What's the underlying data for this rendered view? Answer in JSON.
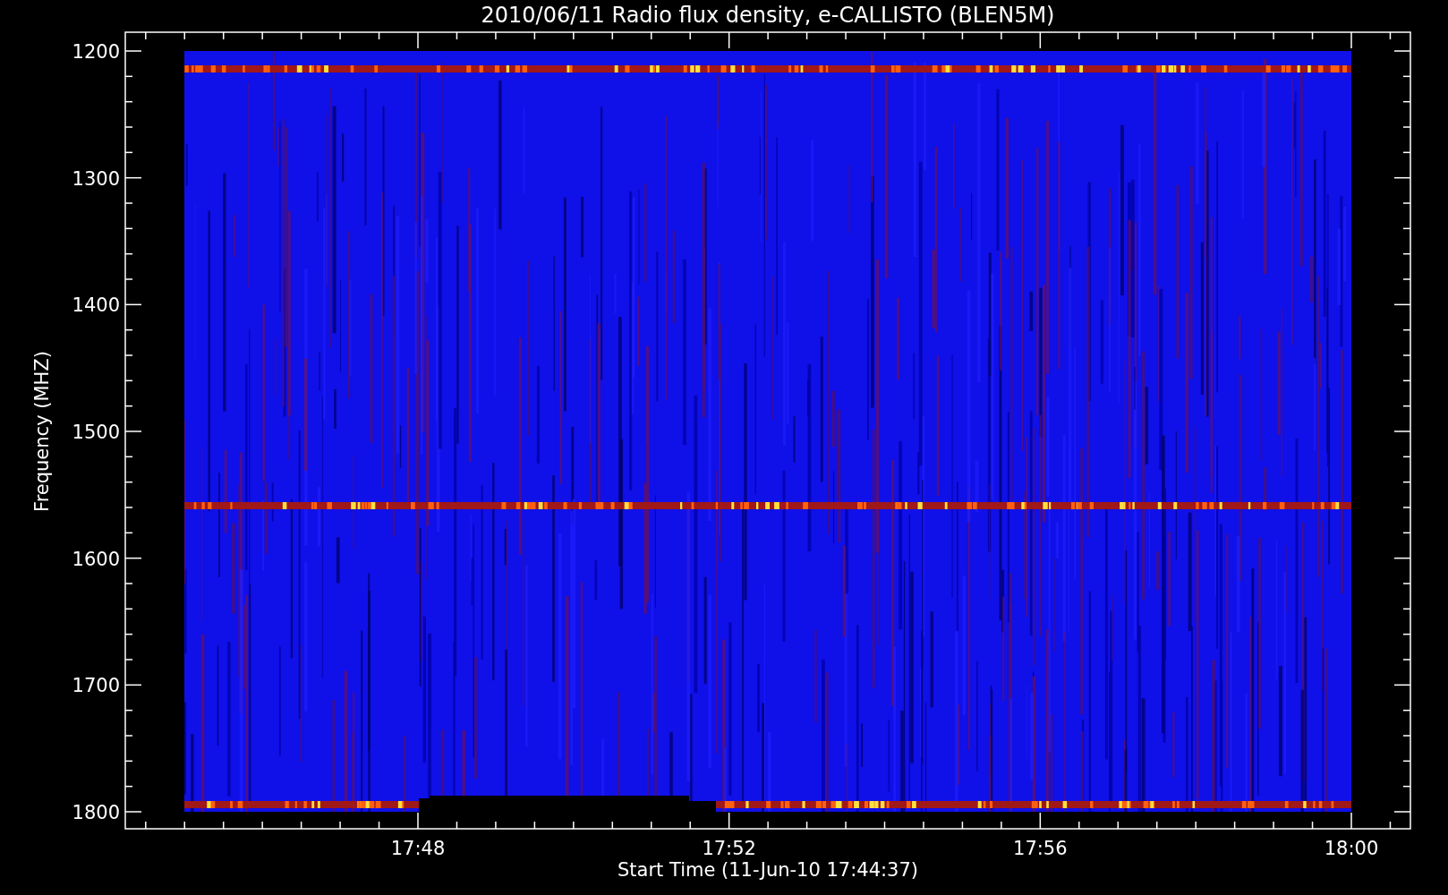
{
  "title": "2010/06/11  Radio flux density, e-CALLISTO (BLEN5M)",
  "y_axis": {
    "label": "Frequency (MHZ)",
    "ticks": [
      "1200",
      "1300",
      "1400",
      "1500",
      "1600",
      "1700",
      "1800"
    ]
  },
  "x_axis": {
    "label": "Start Time (11-Jun-10 17:44:37)",
    "ticks": [
      "17:48",
      "17:52",
      "17:56",
      "18:00"
    ]
  }
}
